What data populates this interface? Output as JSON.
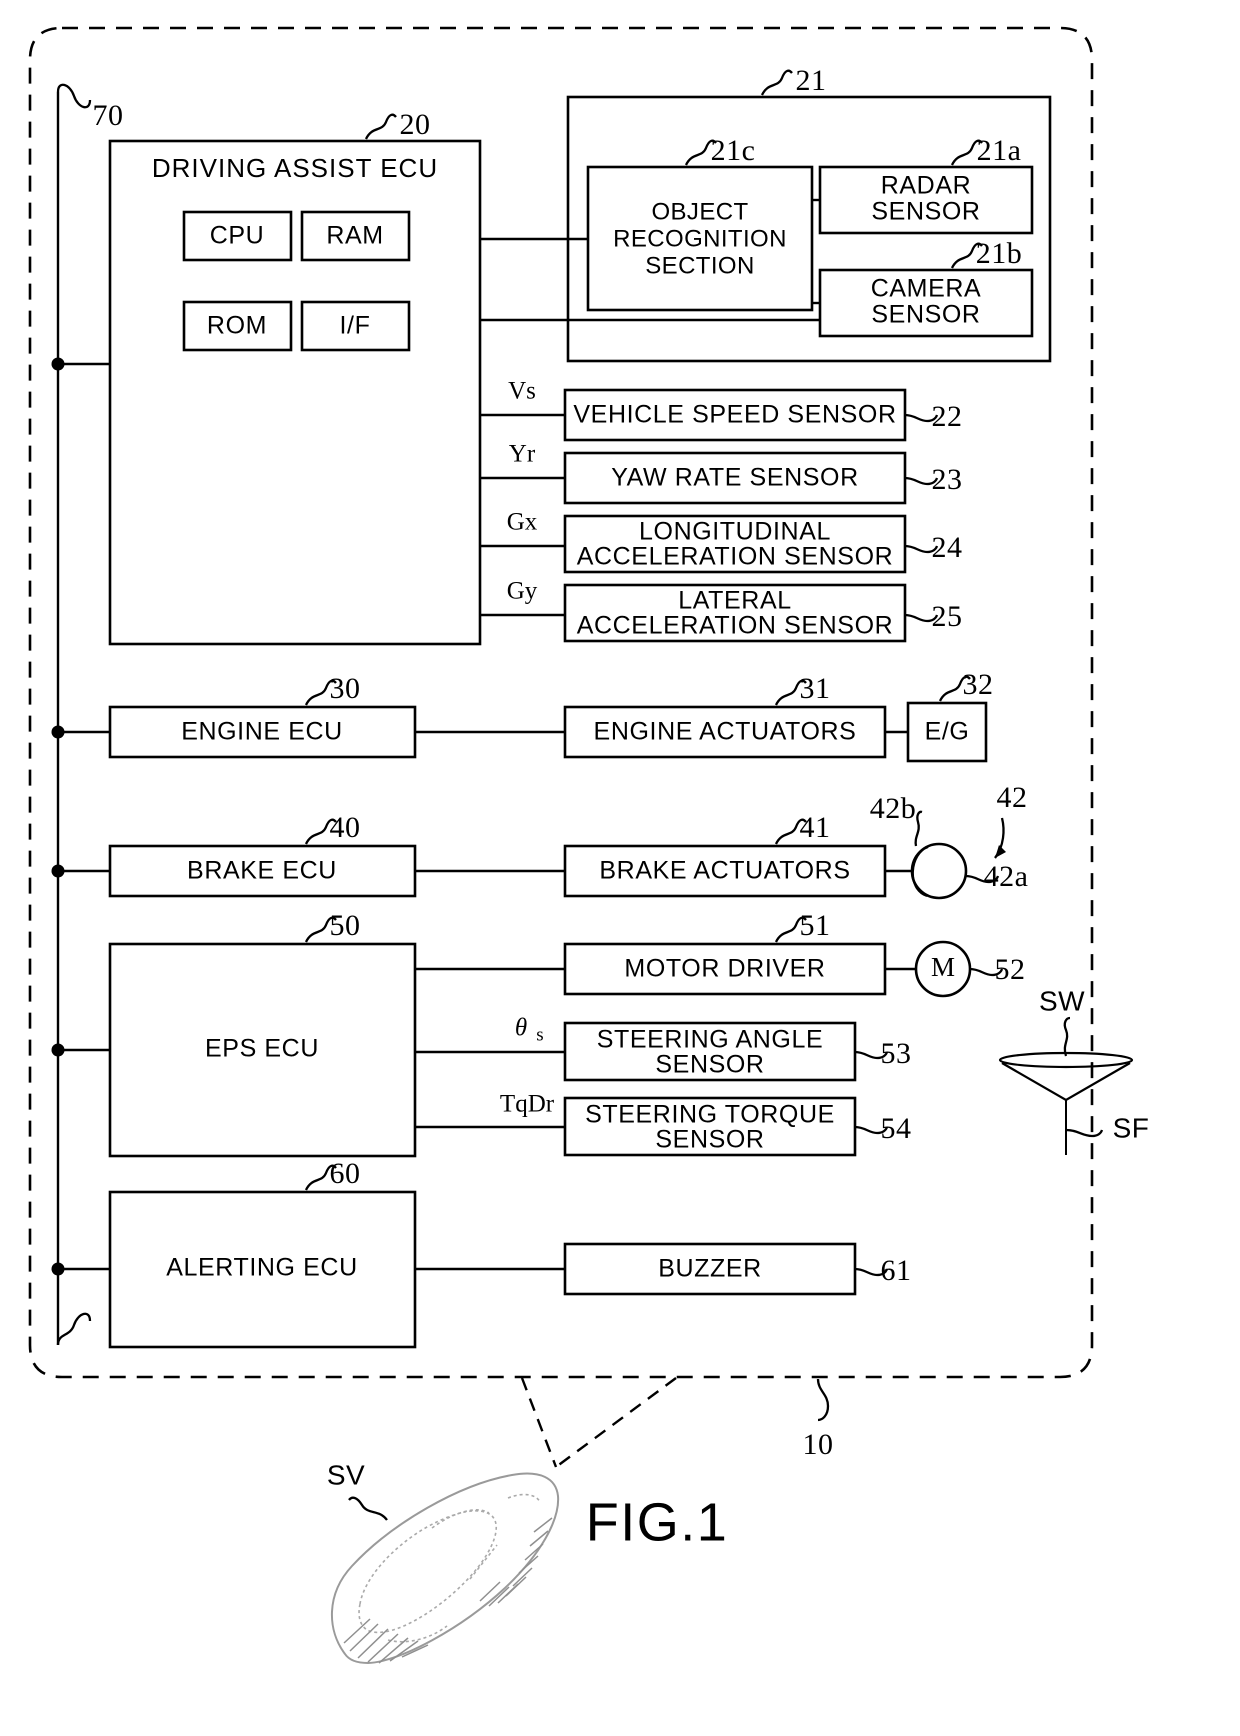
{
  "figure": {
    "label": "FIG.1",
    "system_ref": "10",
    "vehicle_tag": "SV",
    "bus_ref": "70"
  },
  "blocks": {
    "driving_assist_ecu": {
      "label": "DRIVING ASSIST ECU",
      "ref": "20"
    },
    "cpu": {
      "label": "CPU"
    },
    "ram": {
      "label": "RAM"
    },
    "rom": {
      "label": "ROM"
    },
    "if": {
      "label": "I/F"
    },
    "sensor_group": {
      "ref": "21"
    },
    "object_recognition": {
      "line1": "OBJECT",
      "line2": "RECOGNITION",
      "line3": "SECTION",
      "ref": "21c"
    },
    "radar_sensor": {
      "line1": "RADAR",
      "line2": "SENSOR",
      "ref": "21a"
    },
    "camera_sensor": {
      "line1": "CAMERA",
      "line2": "SENSOR",
      "ref": "21b"
    },
    "vehicle_speed_sensor": {
      "label": "VEHICLE SPEED SENSOR",
      "ref": "22",
      "signal": "Vs"
    },
    "yaw_rate_sensor": {
      "label": "YAW RATE SENSOR",
      "ref": "23",
      "signal": "Yr"
    },
    "longitudinal_acceleration_sensor": {
      "line1": "LONGITUDINAL",
      "line2": "ACCELERATION SENSOR",
      "ref": "24",
      "signal": "Gx"
    },
    "lateral_acceleration_sensor": {
      "line1": "LATERAL",
      "line2": "ACCELERATION SENSOR",
      "ref": "25",
      "signal": "Gy"
    },
    "engine_ecu": {
      "label": "ENGINE ECU",
      "ref": "30"
    },
    "engine_actuators": {
      "label": "ENGINE ACTUATORS",
      "ref": "31"
    },
    "engine": {
      "label": "E/G",
      "ref": "32"
    },
    "brake_ecu": {
      "label": "BRAKE ECU",
      "ref": "40"
    },
    "brake_actuators": {
      "label": "BRAKE ACTUATORS",
      "ref": "41"
    },
    "brake_mechanism": {
      "ref": "42",
      "disc_ref": "42a",
      "caliper_ref": "42b"
    },
    "eps_ecu": {
      "label": "EPS ECU",
      "ref": "50"
    },
    "motor_driver": {
      "label": "MOTOR DRIVER",
      "ref": "51"
    },
    "motor": {
      "label": "M",
      "ref": "52"
    },
    "steering_angle_sensor": {
      "line1": "STEERING ANGLE",
      "line2": "SENSOR",
      "ref": "53",
      "signal_greek": "θ",
      "signal_sub": "s"
    },
    "steering_torque_sensor": {
      "line1": "STEERING TORQUE",
      "line2": "SENSOR",
      "ref": "54",
      "signal": "TqDr"
    },
    "steering_wheel": {
      "tag": "SW"
    },
    "steering_shaft": {
      "tag": "SF"
    },
    "alerting_ecu": {
      "label": "ALERTING ECU",
      "ref": "60"
    },
    "buzzer": {
      "label": "BUZZER",
      "ref": "61"
    }
  }
}
